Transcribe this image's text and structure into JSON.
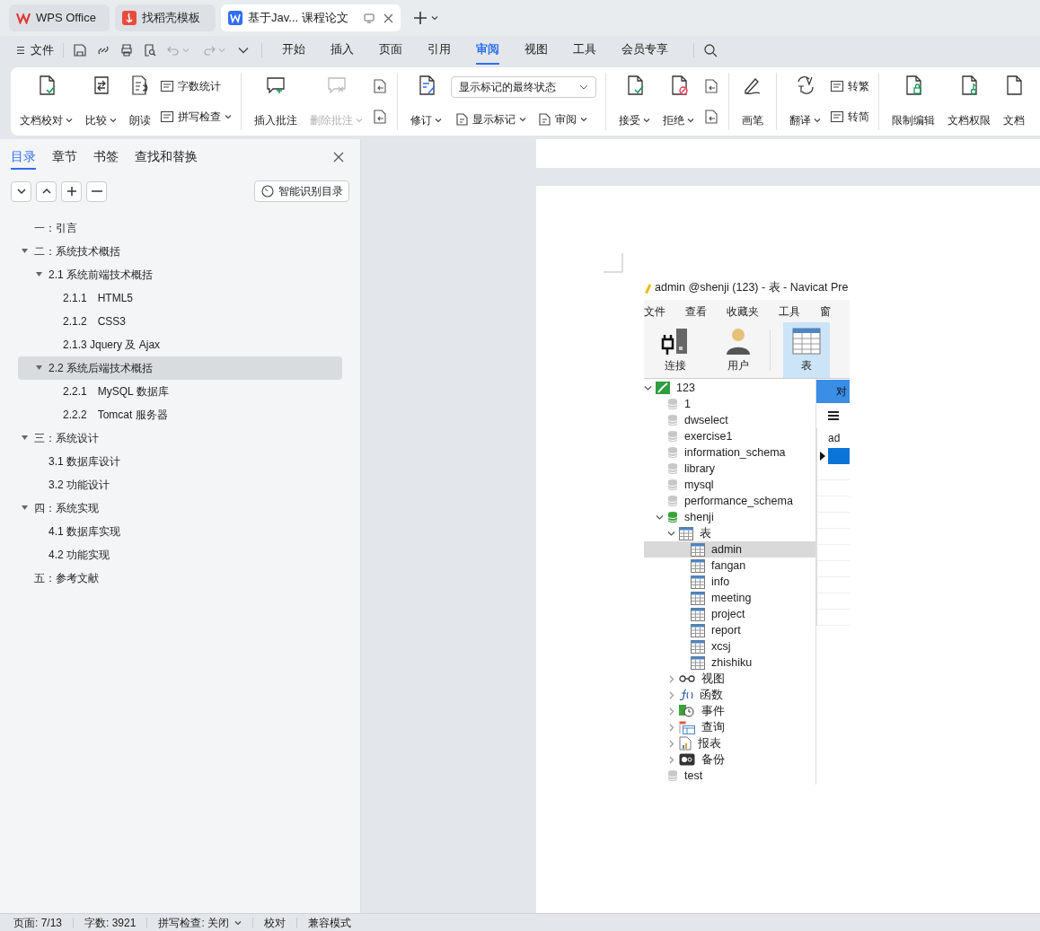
{
  "app_tabs": [
    {
      "label": "WPS Office",
      "kind": "home",
      "selected": false
    },
    {
      "label": "找稻壳模板",
      "kind": "template",
      "selected": false
    },
    {
      "label": "基于Jav... 课程论文",
      "kind": "doc",
      "selected": true
    }
  ],
  "menu": {
    "file": "文件",
    "tabs": [
      {
        "label": "开始",
        "selected": false
      },
      {
        "label": "插入",
        "selected": false
      },
      {
        "label": "页面",
        "selected": false
      },
      {
        "label": "引用",
        "selected": false
      },
      {
        "label": "审阅",
        "selected": true
      },
      {
        "label": "视图",
        "selected": false
      },
      {
        "label": "工具",
        "selected": false
      },
      {
        "label": "会员专享",
        "selected": false
      }
    ]
  },
  "ribbon": [
    [
      {
        "kind": "big",
        "label": "文档校对",
        "dropdown": true,
        "disabled": false
      },
      {
        "kind": "big",
        "label": "比较",
        "dropdown": true,
        "disabled": false
      },
      {
        "kind": "big",
        "label": "朗读",
        "dropdown": false,
        "disabled": false
      },
      {
        "kind": "pair",
        "items": [
          {
            "label": "字数统计",
            "dropdown": false
          },
          {
            "label": "拼写检查",
            "dropdown": true
          }
        ]
      }
    ],
    [
      {
        "kind": "big",
        "label": "插入批注",
        "dropdown": false,
        "disabled": false
      },
      {
        "kind": "big",
        "label": "删除批注",
        "dropdown": true,
        "disabled": true
      },
      {
        "kind": "icons"
      }
    ],
    [
      {
        "kind": "big",
        "label": "修订",
        "dropdown": true,
        "disabled": false
      },
      {
        "kind": "markup",
        "select": "显示标记的最终状态",
        "items": [
          {
            "label": "显示标记",
            "dropdown": true
          },
          {
            "label": "审阅",
            "dropdown": true
          }
        ]
      }
    ],
    [
      {
        "kind": "big",
        "label": "接受",
        "dropdown": true,
        "disabled": false
      },
      {
        "kind": "big",
        "label": "拒绝",
        "dropdown": true,
        "disabled": false
      },
      {
        "kind": "icons"
      }
    ],
    [
      {
        "kind": "big",
        "label": "画笔",
        "dropdown": false,
        "disabled": false
      }
    ],
    [
      {
        "kind": "big",
        "label": "翻译",
        "dropdown": true,
        "disabled": false
      },
      {
        "kind": "pair",
        "items": [
          {
            "label": "转繁",
            "dropdown": false
          },
          {
            "label": "转简",
            "dropdown": false
          }
        ]
      }
    ],
    [
      {
        "kind": "big",
        "label": "限制编辑",
        "dropdown": false,
        "disabled": false
      },
      {
        "kind": "big",
        "label": "文档权限",
        "dropdown": false,
        "disabled": false
      },
      {
        "kind": "big",
        "label": "文档",
        "dropdown": false,
        "disabled": false
      }
    ]
  ],
  "sidebar": {
    "tabs": [
      {
        "label": "目录",
        "selected": true
      },
      {
        "label": "章节",
        "selected": false
      },
      {
        "label": "书签",
        "selected": false
      },
      {
        "label": "查找和替换",
        "selected": false
      }
    ],
    "smart_button": "智能识别目录",
    "outline": [
      {
        "label": "一：引言",
        "selected": false
      },
      {
        "label": "二：系统技术概括",
        "expanded": true,
        "selected": false,
        "children": [
          {
            "label": "2.1 系统前端技术概括",
            "expanded": true,
            "selected": false,
            "children": [
              {
                "label": "2.1.1　HTML5",
                "selected": false
              },
              {
                "label": "2.1.2　CSS3",
                "selected": false
              },
              {
                "label": "2.1.3 Jquery 及 Ajax",
                "selected": false
              }
            ]
          },
          {
            "label": "2.2 系统后端技术概括",
            "expanded": true,
            "selected": true,
            "children": [
              {
                "label": "2.2.1　MySQL 数据库",
                "selected": false
              },
              {
                "label": "2.2.2　Tomcat 服务器",
                "selected": false
              }
            ]
          }
        ]
      },
      {
        "label": "三：系统设计",
        "expanded": true,
        "selected": false,
        "children": [
          {
            "label": "3.1 数据库设计",
            "selected": false
          },
          {
            "label": "3.2 功能设计",
            "selected": false
          }
        ]
      },
      {
        "label": "四：系统实现",
        "expanded": true,
        "selected": false,
        "children": [
          {
            "label": "4.1 数据库实现",
            "selected": false
          },
          {
            "label": "4.2 功能实现",
            "selected": false
          }
        ]
      },
      {
        "label": "五：参考文献",
        "selected": false
      }
    ]
  },
  "navicat": {
    "title": "admin @shenji (123) - 表 - Navicat Pre",
    "menu": [
      "文件",
      "查看",
      "收藏夹",
      "工具",
      "窗"
    ],
    "toolbar": [
      {
        "label": "连接",
        "kind": "connect",
        "selected": false
      },
      {
        "label": "用户",
        "kind": "user",
        "selected": false
      },
      {
        "label": "表",
        "kind": "table",
        "selected": true
      }
    ],
    "tab": "对",
    "column": "ad",
    "tree": [
      {
        "label": "123",
        "kind": "connection",
        "expanded": true,
        "selected": false,
        "children": [
          {
            "label": "1",
            "kind": "database",
            "selected": false
          },
          {
            "label": "dwselect",
            "kind": "database",
            "selected": false
          },
          {
            "label": "exercise1",
            "kind": "database",
            "selected": false
          },
          {
            "label": "information_schema",
            "kind": "database",
            "selected": false
          },
          {
            "label": "library",
            "kind": "database",
            "selected": false
          },
          {
            "label": "mysql",
            "kind": "database",
            "selected": false
          },
          {
            "label": "performance_schema",
            "kind": "database",
            "selected": false
          },
          {
            "label": "shenji",
            "kind": "open_database",
            "expanded": true,
            "selected": false,
            "children": [
              {
                "label": "表",
                "kind": "tables",
                "expanded": true,
                "selected": false,
                "children": [
                  {
                    "label": "admin",
                    "kind": "table",
                    "selected": true
                  },
                  {
                    "label": "fangan",
                    "kind": "table",
                    "selected": false
                  },
                  {
                    "label": "info",
                    "kind": "table",
                    "selected": false
                  },
                  {
                    "label": "meeting",
                    "kind": "table",
                    "selected": false
                  },
                  {
                    "label": "project",
                    "kind": "table",
                    "selected": false
                  },
                  {
                    "label": "report",
                    "kind": "table",
                    "selected": false
                  },
                  {
                    "label": "xcsj",
                    "kind": "table",
                    "selected": false
                  },
                  {
                    "label": "zhishiku",
                    "kind": "table",
                    "selected": false
                  }
                ]
              },
              {
                "label": "视图",
                "kind": "views",
                "expanded": false,
                "selected": false
              },
              {
                "label": "函数",
                "kind": "functions",
                "expanded": false,
                "selected": false
              },
              {
                "label": "事件",
                "kind": "events",
                "expanded": false,
                "selected": false
              },
              {
                "label": "查询",
                "kind": "queries",
                "expanded": false,
                "selected": false
              },
              {
                "label": "报表",
                "kind": "reports",
                "expanded": false,
                "selected": false
              },
              {
                "label": "备份",
                "kind": "backups",
                "expanded": false,
                "selected": false
              }
            ]
          },
          {
            "label": "test",
            "kind": "database",
            "selected": false
          }
        ]
      }
    ]
  },
  "status_bar": [
    {
      "label": "页面: 7/13",
      "dropdown": false
    },
    {
      "label": "字数: 3921",
      "dropdown": false
    },
    {
      "label": "拼写检查: 关闭",
      "dropdown": true
    },
    {
      "label": "校对",
      "dropdown": false
    },
    {
      "label": "兼容模式",
      "dropdown": false
    }
  ]
}
